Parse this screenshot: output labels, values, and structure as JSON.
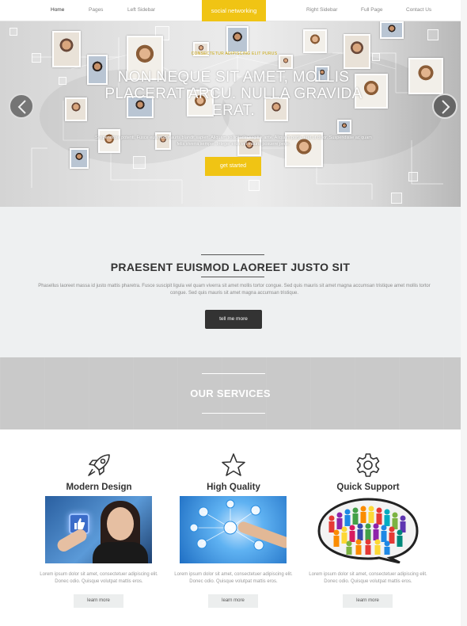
{
  "nav": {
    "items": [
      "Home",
      "Pages",
      "Left Sidebar",
      "Right Sidebar",
      "Full Page",
      "Contact Us"
    ],
    "brand": "social networking",
    "active": "Home"
  },
  "hero": {
    "tagline": "CONSECTETUR ADIPISCING ELIT PURUS",
    "title": "NON NEQUE SIT AMET, MOLLIS PLACERAT ARCU. NULLA GRAVIDA ERAT.",
    "text": "Suspendisse potenti. Fusce euismod mauris blandit sapien. Aliquam sollicitudin sagittis ante. Aliquam porta, erat ut dolor. Suspendisse ac quam felis viverra semper. Integer eros vel mauris posuere pede.",
    "button": "get started",
    "prev_icon": "chevron-left-icon",
    "next_icon": "chevron-right-icon"
  },
  "intro": {
    "heading": "PRAESENT EUISMOD LAOREET JUSTO SIT",
    "text": "Phasellus laoreet massa id justo mattis pharetra. Fusce suscipit ligula vel quam viverra sit amet mollis tortor congue. Sed quis mauris sit amet magna accumsan tristique amet mollis tortor congue. Sed quis mauris sit amet magna accumsan tristique.",
    "button": "tell me more"
  },
  "services_banner": {
    "heading": "OUR SERVICES"
  },
  "services": [
    {
      "icon": "rocket-icon",
      "title": "Modern Design",
      "text": "Lorem ipsum dolor sit amet, consectetuer adipiscing elit. Donec odio. Quisque volutpat mattis eros.",
      "button": "learn more"
    },
    {
      "icon": "star-icon",
      "title": "High Quality",
      "text": "Lorem ipsum dolor sit amet, consectetuer adipiscing elit. Donec odio. Quisque volutpat mattis eros.",
      "button": "learn more"
    },
    {
      "icon": "gear-icon",
      "title": "Quick Support",
      "text": "Lorem ipsum dolor sit amet, consectetuer adipiscing elit. Donec odio. Quisque volutpat mattis eros.",
      "button": "learn more"
    }
  ],
  "colors": {
    "accent": "#f0c414",
    "dark_button": "#333333",
    "section_bg": "#eef0f1",
    "services_banner_bg": "#c9c9c9"
  }
}
